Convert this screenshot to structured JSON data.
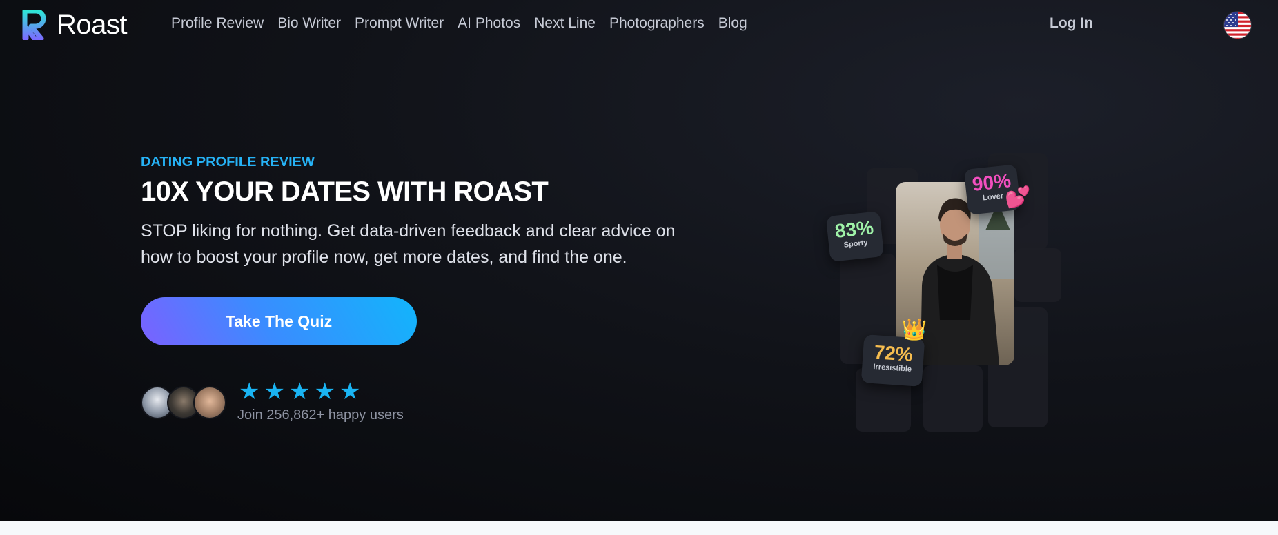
{
  "brand": {
    "name": "Roast"
  },
  "nav": {
    "links": [
      "Profile Review",
      "Bio Writer",
      "Prompt Writer",
      "AI Photos",
      "Next Line",
      "Photographers",
      "Blog"
    ],
    "login": "Log In",
    "language_icon": "us-flag-icon"
  },
  "hero": {
    "eyebrow": "DATING PROFILE REVIEW",
    "headline": "10X YOUR DATES WITH ROAST",
    "subtext": "STOP liking for nothing. Get data-driven feedback and clear advice on how to boost your profile now, get more dates, and find the one.",
    "cta": "Take The Quiz",
    "rating_stars": 5,
    "social_proof": "Join 256,862+ happy users"
  },
  "collage": {
    "badges": [
      {
        "value": "90%",
        "label": "Lover",
        "color": "#f24fbf"
      },
      {
        "value": "83%",
        "label": "Sporty",
        "color": "#9ff2a8"
      },
      {
        "value": "72%",
        "label": "Irresistible",
        "color": "#f6bd4f"
      }
    ],
    "emojis": {
      "hearts": "💕",
      "crown": "👑"
    }
  },
  "colors": {
    "accent": "#26b2f5",
    "cta_gradient_start": "#7b61ff",
    "cta_gradient_end": "#12b5fb",
    "background": "#111319"
  }
}
